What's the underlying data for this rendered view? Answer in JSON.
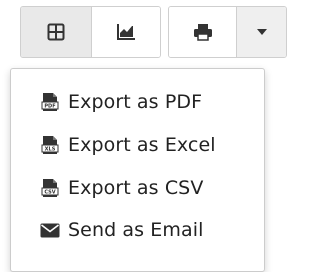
{
  "toolbar": {
    "view_buttons": [
      {
        "icon": "table-grid-icon",
        "active": true
      },
      {
        "icon": "area-chart-icon",
        "active": false
      }
    ],
    "print_icon": "printer-icon",
    "dropdown_icon": "caret-down-icon"
  },
  "export_menu": {
    "items": [
      {
        "icon": "pdf-file-icon",
        "badge": "PDF",
        "label": "Export as PDF"
      },
      {
        "icon": "xls-file-icon",
        "badge": "XLS",
        "label": "Export as Excel"
      },
      {
        "icon": "csv-file-icon",
        "badge": "CSV",
        "label": "Export as CSV"
      },
      {
        "icon": "envelope-icon",
        "label": "Send as Email"
      }
    ]
  },
  "colors": {
    "icon": "#333333",
    "text": "#222222",
    "border": "#cfcfcf",
    "active_bg": "#e9e9e9"
  }
}
